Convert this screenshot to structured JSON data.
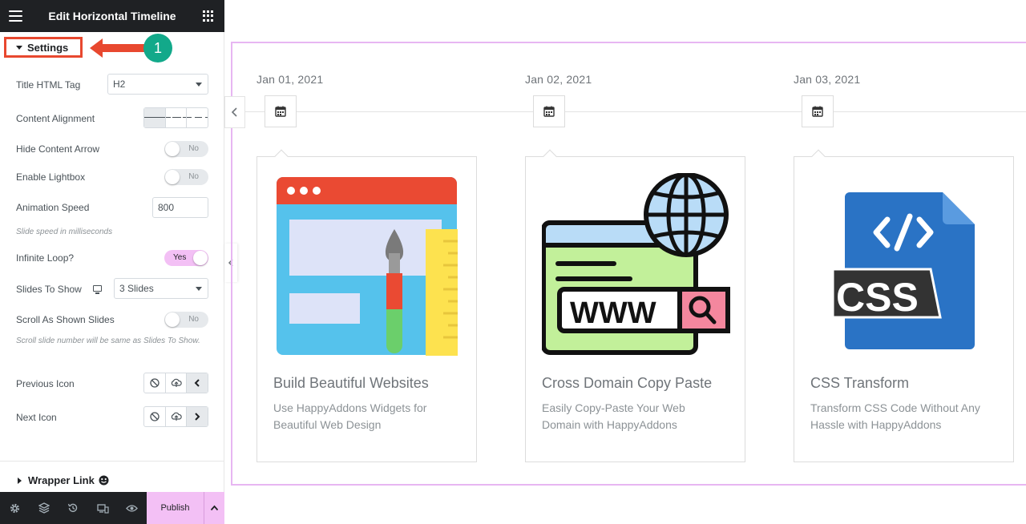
{
  "header": {
    "title": "Edit Horizontal Timeline"
  },
  "settings_section": {
    "label": "Settings",
    "callout_number": "1"
  },
  "controls": {
    "title_tag": {
      "label": "Title HTML Tag",
      "value": "H2"
    },
    "content_alignment": {
      "label": "Content Alignment"
    },
    "hide_arrow": {
      "label": "Hide Content Arrow",
      "value": "No"
    },
    "lightbox": {
      "label": "Enable Lightbox",
      "value": "No"
    },
    "animation_speed": {
      "label": "Animation Speed",
      "value": "800",
      "hint": "Slide speed in milliseconds"
    },
    "infinite_loop": {
      "label": "Infinite Loop?",
      "value": "Yes"
    },
    "slides_to_show": {
      "label": "Slides To Show",
      "value": "3 Slides"
    },
    "scroll_as_shown": {
      "label": "Scroll As Shown Slides",
      "value": "No",
      "hint": "Scroll slide number will be same as Slides To Show."
    },
    "previous_icon": {
      "label": "Previous Icon"
    },
    "next_icon": {
      "label": "Next Icon"
    }
  },
  "wrapper_link": {
    "label": "Wrapper Link"
  },
  "footer": {
    "publish_label": "Publish"
  },
  "timeline": {
    "items": [
      {
        "date": "Jan 01, 2021",
        "title": "Build Beautiful Websites",
        "description": "Use HappyAddons Widgets for Beautiful Web Design",
        "image": "website-design-illustration"
      },
      {
        "date": "Jan 02, 2021",
        "title": "Cross Domain Copy Paste",
        "description": "Easily Copy-Paste Your Web Domain with HappyAddons",
        "image": "www-globe-illustration"
      },
      {
        "date": "Jan 03, 2021",
        "title": "CSS Transform",
        "description": "Transform CSS Code Without Any Hassle with HappyAddons",
        "image": "css-file-illustration"
      }
    ]
  },
  "colors": {
    "accent_pink": "#f3c0f5",
    "callout_red": "#e8482f",
    "badge_green": "#12a98a",
    "dark": "#1f2124"
  }
}
